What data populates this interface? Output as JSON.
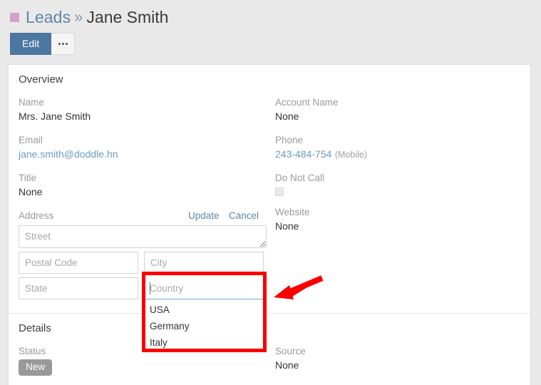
{
  "breadcrumb": {
    "square_icon": "pink-square-icon",
    "parent": "Leads",
    "separator": "»",
    "current": "Jane Smith"
  },
  "toolbar": {
    "edit_label": "Edit",
    "more_icon": "ellipsis-icon"
  },
  "panels": [
    {
      "title": "Overview"
    },
    {
      "title": "Details"
    }
  ],
  "overview": {
    "title": "Overview",
    "left": {
      "name_label": "Name",
      "name_value": "Mrs. Jane Smith",
      "email_label": "Email",
      "email_value": "jane.smith@doddle.hn",
      "title_label": "Title",
      "title_value": "None",
      "address_label": "Address",
      "update_label": "Update",
      "cancel_label": "Cancel"
    },
    "right": {
      "account_name_label": "Account Name",
      "account_name_value": "None",
      "phone_label": "Phone",
      "phone_value": "243-484-754",
      "phone_type": "(Mobile)",
      "do_not_call_label": "Do Not Call",
      "do_not_call_checked": false,
      "website_label": "Website",
      "website_value": "None"
    }
  },
  "address_form": {
    "street_placeholder": "Street",
    "street_value": "",
    "postal_code_placeholder": "Postal Code",
    "postal_code_value": "",
    "city_placeholder": "City",
    "city_value": "",
    "state_placeholder": "State",
    "state_value": "",
    "country_placeholder": "Country",
    "country_value": "",
    "country_suggestions": [
      "USA",
      "Germany",
      "Italy"
    ]
  },
  "details": {
    "title": "Details",
    "status_label": "Status",
    "status_value": "New",
    "source_label": "Source",
    "source_value": "None"
  },
  "colors": {
    "page_bg": "#e9e9e9",
    "panel_bg": "#ffffff",
    "primary_button": "#4b77a0",
    "link": "#6e9bc2",
    "breadcrumb_parent": "#5e87a8",
    "breadcrumb_square": "#d3a3ca",
    "label_gray": "#9a9a9a",
    "status_badge": "#999999",
    "annotation_red": "#fc0000",
    "focus_underline": "#6fa8dc"
  },
  "annotations": {
    "highlight_target": "country-field-with-suggestions",
    "arrow": "red-arrow-pointing-left"
  }
}
